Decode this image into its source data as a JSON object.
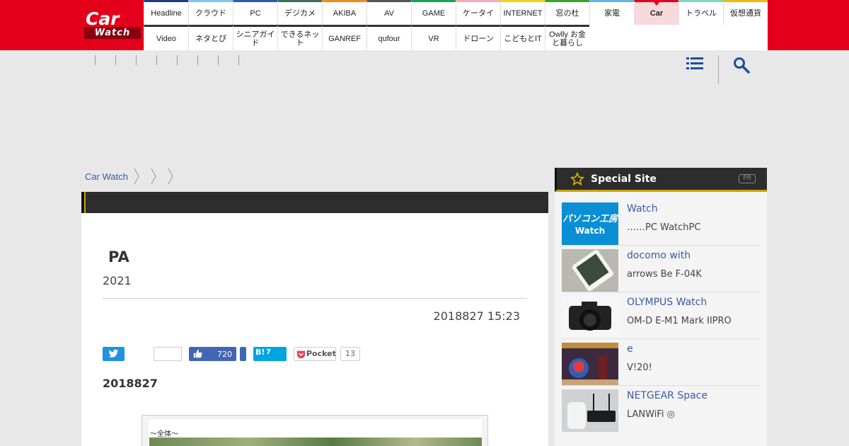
{
  "brand": {
    "logo_car": "Car",
    "logo_watch": "Watch",
    "accent": "#e4001b"
  },
  "nav": {
    "row1": [
      "Headline",
      "クラウド",
      "PC",
      "デジカメ",
      "AKIBA",
      "AV",
      "GAME",
      "ケータイ",
      "INTERNET",
      "窓の杜",
      "家電",
      "Car",
      "トラベル",
      "仮想通貨"
    ],
    "row2": [
      "Video",
      "ネタとぴ",
      "シニアガイド",
      "できるネット",
      "GANREF",
      "qufour",
      "VR",
      "ドローン",
      "こどもとIT",
      "Owlly お金と暮らし"
    ],
    "row1_colors": [
      "#1a3c7a",
      "#7ec7e8",
      "#2c5ab8",
      "#3c6e5a",
      "#f08c1e",
      "#555555",
      "#16a34a",
      "#f7a8b8",
      "#f2d31b",
      "#3aa12e",
      "#5fb4e8",
      "#e4001b",
      "#7fd6c1",
      "#f0b70f"
    ],
    "active": "Car"
  },
  "breadcrumb": {
    "home": "Car Watch"
  },
  "article": {
    "title": "PA",
    "subtitle": "2021",
    "date": "2018827 15:23",
    "post_date": "2018827",
    "figure_caption": "〜全体〜"
  },
  "share": {
    "fb_count": "720",
    "hb_label": "B!",
    "hb_count": "7",
    "pocket_label": "Pocket",
    "pocket_count": "13"
  },
  "sidebar": {
    "title": "Special Site",
    "pr": "PR",
    "items": [
      {
        "title": " Watch",
        "desc": "……PC WatchPC",
        "thumb": "pc-koubou-logo"
      },
      {
        "title": "docomo with",
        "desc": "arrows Be F-04K",
        "thumb": "smartphone"
      },
      {
        "title": "OLYMPUS Watch",
        "desc": "OM-D E-M1 Mark IIPRO",
        "thumb": "camera"
      },
      {
        "title": "e",
        "desc": "V!20!",
        "thumb": "game"
      },
      {
        "title": "NETGEAR Space",
        "desc": "LANWiFi ◎",
        "thumb": "router"
      }
    ],
    "pc_logo_top": "パソコン工房",
    "pc_logo_bottom": "Watch"
  }
}
